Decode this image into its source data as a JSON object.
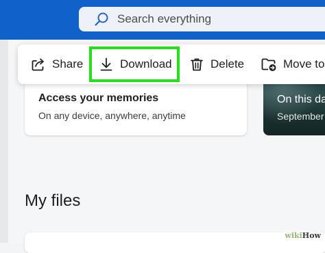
{
  "search": {
    "placeholder": "Search everything"
  },
  "toolbar": {
    "share_label": "Share",
    "download_label": "Download",
    "delete_label": "Delete",
    "move_label": "Move to"
  },
  "cards": {
    "access": {
      "title": "Access your memories",
      "subtitle": "On any device, anywhere, anytime"
    },
    "photo": {
      "title": "On this day",
      "subtitle": "September"
    }
  },
  "main": {
    "section_title": "My files"
  },
  "watermark": {
    "wiki": "wiki",
    "how": "How"
  },
  "icons": {
    "search": "search-icon",
    "share": "share-icon",
    "download": "download-icon",
    "delete": "trash-icon",
    "move": "folder-move-icon"
  },
  "colors": {
    "header": "#0f62c9",
    "highlight": "#22e01a",
    "accent": "#0f62c9"
  }
}
